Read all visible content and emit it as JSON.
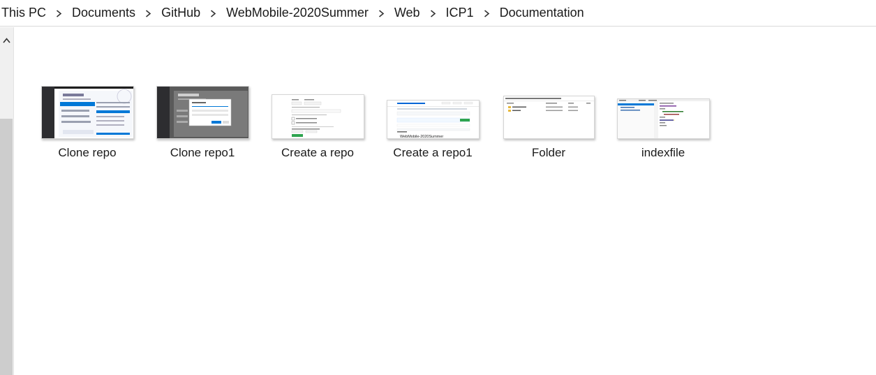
{
  "breadcrumb": {
    "items": [
      "This PC",
      "Documents",
      "GitHub",
      "WebMobile-2020Summer",
      "Web",
      "ICP1",
      "Documentation"
    ]
  },
  "files": [
    {
      "name": "Clone repo",
      "thumb_style": "vs-dark-start"
    },
    {
      "name": "Clone repo1",
      "thumb_style": "vs-dark-dialog"
    },
    {
      "name": "Create a repo",
      "thumb_style": "github-form"
    },
    {
      "name": "Create a repo1",
      "thumb_style": "github-repo"
    },
    {
      "name": "Folder",
      "thumb_style": "explorer-list"
    },
    {
      "name": "indexfile",
      "thumb_style": "ide-editor"
    }
  ],
  "colors": {
    "accent": "#0078d7",
    "hover": "#e5f3ff",
    "scrollbar_thumb": "#cdcdcd",
    "github_green": "#2ea44f"
  }
}
